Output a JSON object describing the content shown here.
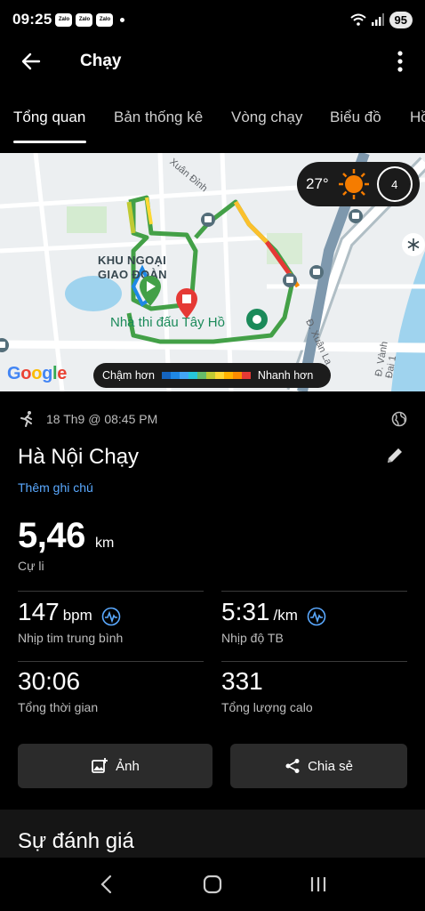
{
  "status_bar": {
    "time": "09:25",
    "notification_icons": [
      "Zalo",
      "Zalo",
      "Zalo"
    ],
    "battery": "95"
  },
  "app_bar": {
    "title": "Chạy"
  },
  "tabs": [
    {
      "label": "Tổng quan",
      "active": true
    },
    {
      "label": "Bản thống kê",
      "active": false
    },
    {
      "label": "Vòng chạy",
      "active": false
    },
    {
      "label": "Biểu đồ",
      "active": false
    },
    {
      "label": "Hồ",
      "active": false
    }
  ],
  "map": {
    "labels": {
      "street_top": "Xuân Đỉnh",
      "area": "KHU NGOẠI GIAO ĐOÀN",
      "venue": "Nhà thi đấu Tây Hồ",
      "street_right": "Đ. Xuân La",
      "street_far_right": "Đ. Vành Đai 1"
    },
    "weather": {
      "temperature": "27°",
      "moon_phase": "4"
    },
    "legend": {
      "slow_label": "Chậm hơn",
      "fast_label": "Nhanh hơn",
      "colors": [
        "#1565c0",
        "#1e88e5",
        "#42a5f5",
        "#26c6da",
        "#66bb6a",
        "#c0ca33",
        "#fdd835",
        "#ffb300",
        "#fb8c00",
        "#e53935"
      ]
    },
    "logo": "Google"
  },
  "activity": {
    "date": "18 Th9 @ 08:45 PM",
    "title": "Hà Nội Chạy",
    "add_note": "Thêm ghi chú",
    "distance": {
      "value": "5,46",
      "unit": "km",
      "label": "Cự li"
    },
    "metrics": [
      {
        "value": "147",
        "unit": "bpm",
        "label": "Nhịp tim trung bình",
        "has_zone_icon": true
      },
      {
        "value": "5:31",
        "unit": "/km",
        "label": "Nhịp độ TB",
        "has_zone_icon": true
      },
      {
        "value": "30:06",
        "unit": "",
        "label": "Tổng thời gian",
        "has_zone_icon": false
      },
      {
        "value": "331",
        "unit": "",
        "label": "Tổng lượng calo",
        "has_zone_icon": false
      }
    ],
    "buttons": {
      "photo": "Ảnh",
      "share": "Chia sẻ"
    }
  },
  "evaluation": {
    "title": "Sự đánh giá"
  },
  "colors": {
    "accent": "#5aa9ff",
    "background": "#000000",
    "route_green": "#43a047",
    "start_marker": "#43a047",
    "end_marker": "#e53935"
  }
}
